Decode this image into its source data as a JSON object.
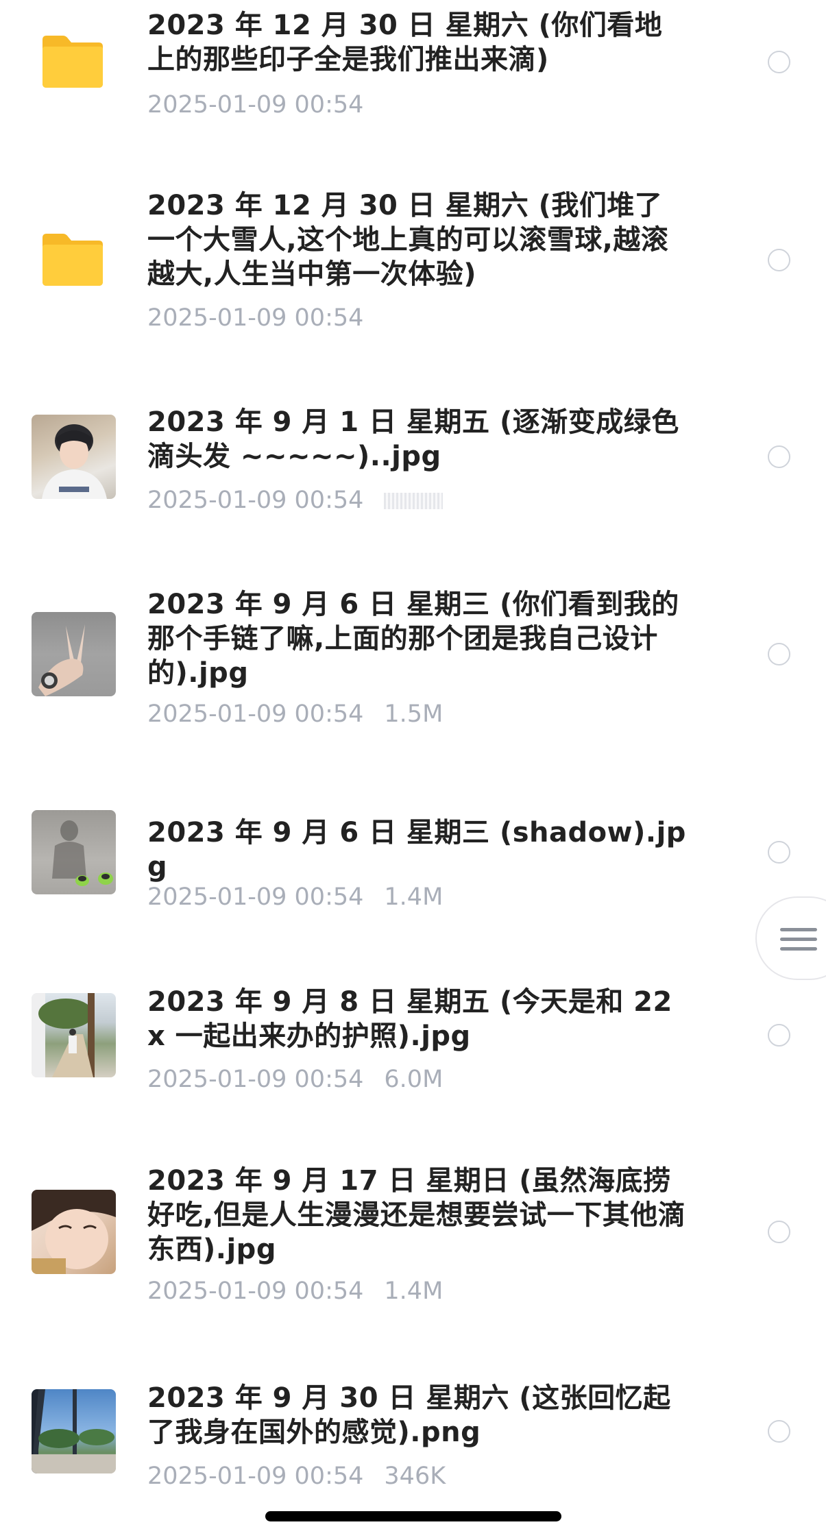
{
  "files": [
    {
      "type": "folder",
      "icon": "folder-icon",
      "title": "2023 年 12 月 30 日 星期六 (你们看地上的那些印子全是我们推出来滴)",
      "date": "2025-01-09 00:54",
      "size": ""
    },
    {
      "type": "folder",
      "icon": "folder-icon",
      "title": "2023 年 12 月 30 日 星期六 (我们堆了一个大雪人,这个地上真的可以滚雪球,越滚越大,人生当中第一次体验)",
      "date": "2025-01-09 00:54",
      "size": ""
    },
    {
      "type": "image",
      "icon": "photo-thumbnail-selfie",
      "title": "2023 年 9 月 1 日 星期五 (逐渐变成绿色滴头发 ~~~~~)..jpg",
      "date": "2025-01-09 00:54",
      "size": ""
    },
    {
      "type": "image",
      "icon": "photo-thumbnail-hand-bracelet",
      "title": "2023 年 9 月 6 日 星期三 (你们看到我的那个手链了嘛,上面的那个团是我自己设计的).jpg",
      "date": "2025-01-09 00:54",
      "size": "1.5M"
    },
    {
      "type": "image",
      "icon": "photo-thumbnail-shadow",
      "title": "2023 年 9 月 6 日 星期三 (shadow).jpg",
      "date": "2025-01-09 00:54",
      "size": "1.4M"
    },
    {
      "type": "image",
      "icon": "photo-thumbnail-street",
      "title": "2023 年 9 月 8 日 星期五 (今天是和 22x 一起出来办的护照).jpg",
      "date": "2025-01-09 00:54",
      "size": "6.0M"
    },
    {
      "type": "image",
      "icon": "photo-thumbnail-face",
      "title": "2023 年 9 月 17 日 星期日 (虽然海底捞好吃,但是人生漫漫还是想要尝试一下其他滴东西).jpg",
      "date": "2025-01-09 00:54",
      "size": "1.4M"
    },
    {
      "type": "image",
      "icon": "photo-thumbnail-window-view",
      "title": "2023 年 9 月 30 日 星期六 (这张回忆起了我身在国外的感觉).png",
      "date": "2025-01-09 00:54",
      "size": "346K"
    }
  ],
  "side_handle_icon": "menu-lines-icon",
  "colors": {
    "title": "#222222",
    "meta": "#a9aeb8",
    "folder": "#ffc93c",
    "radio_border": "#cfd3da"
  }
}
